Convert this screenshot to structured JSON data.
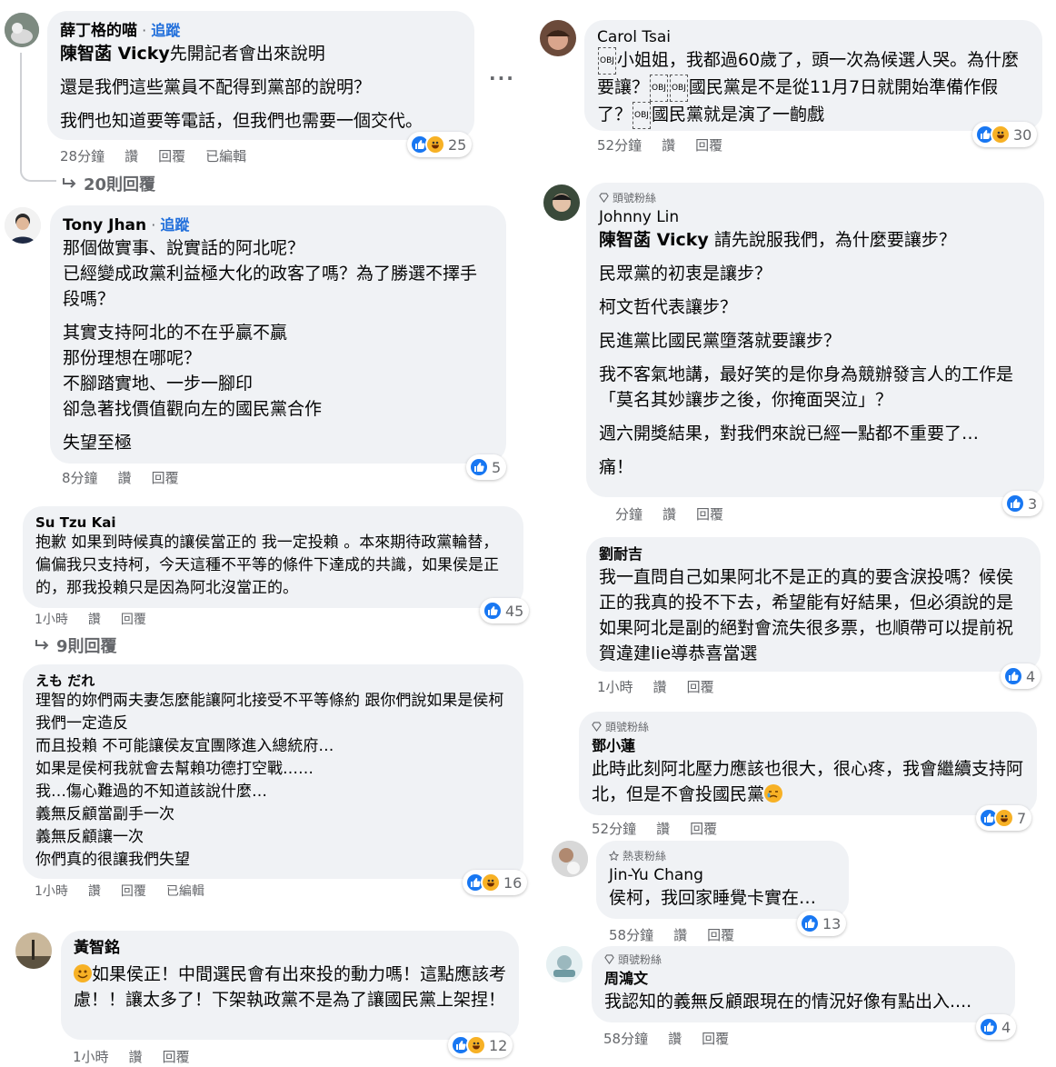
{
  "left": {
    "c1": {
      "name": "薛丁格的喵",
      "follow": "追蹤",
      "mention": "陳智菡 Vicky",
      "first": "先開記者會出來說明",
      "lines": [
        "還是我們這些黨員不配得到黨部的說明？",
        "我們也知道要等電話，但我們也需要一個交代。"
      ],
      "time": "28分鐘",
      "like": "讚",
      "reply": "回覆",
      "edited": "已編輯",
      "count": "25",
      "replies": "20則回覆"
    },
    "c2": {
      "name": "Tony Jhan",
      "follow": "追蹤",
      "p1": "那個做實事、說實話的阿北呢？\n已經變成政黨利益極大化的政客了嗎？為了勝選不擇手段嗎？",
      "p2": "其實支持阿北的不在乎贏不贏\n那份理想在哪呢？\n不腳踏實地、一步一腳印\n卻急著找價值觀向左的國民黨合作",
      "p3": "失望至極",
      "time": "8分鐘",
      "like": "讚",
      "reply": "回覆",
      "count": "5"
    },
    "c3": {
      "name": "Su Tzu Kai",
      "text": "抱歉 如果到時候真的讓侯當正的 我一定投賴 。本來期待政黨輪替，偏偏我只支持柯，今天這種不平等的條件下達成的共識，如果侯是正的，那我投賴只是因為阿北沒當正的。",
      "time": "1小時",
      "like": "讚",
      "reply": "回覆",
      "count": "45",
      "replies": "9則回覆"
    },
    "c4": {
      "name": "えも だれ",
      "text": "理智的妳們兩夫妻怎麼能讓阿北接受不平等條約 跟你們說如果是侯柯 我們一定造反\n而且投賴 不可能讓侯友宜團隊進入總統府…\n如果是侯柯我就會去幫賴功德打空戰……\n我…傷心難過的不知道該說什麼…\n義無反顧當副手一次\n義無反顧讓一次\n你們真的很讓我們失望",
      "time": "1小時",
      "like": "讚",
      "reply": "回覆",
      "edited": "已編輯",
      "count": "16"
    },
    "c5": {
      "name": "黃智銘",
      "text": "如果侯正！中間選民會有出來投的動力嗎！這點應該考慮！！讓太多了！下架執政黨不是為了讓國民黨上架捏！",
      "time": "1小時",
      "like": "讚",
      "reply": "回覆",
      "count": "12"
    }
  },
  "right": {
    "c1": {
      "name": "Carol Tsai",
      "t1": "小姐姐，我都過60歲了，頭一次為候選人哭。為什麼要讓？",
      "t2": "國民黨是不是從11月7日就開始準備作假了？",
      "t3": "國民黨就是演了一齣戲",
      "obj": "OBJ",
      "time": "52分鐘",
      "like": "讚",
      "reply": "回覆",
      "count": "30"
    },
    "c2": {
      "badge": "頭號粉絲",
      "name": "Johnny Lin",
      "mention": "陳智菡 Vicky",
      "first": " 請先說服我們，為什麼要讓步？",
      "lines": [
        "民眾黨的初衷是讓步？",
        "柯文哲代表讓步？",
        "民進黨比國民黨墮落就要讓步？",
        "我不客氣地講，最好笑的是你身為競辦發言人的工作是「莫名其妙讓步之後，你掩面哭泣」？",
        "週六開獎結果，對我們來說已經一點都不重要了…",
        "痛！"
      ],
      "time": "分鐘",
      "like": "讚",
      "reply": "回覆",
      "count": "3"
    },
    "c3": {
      "name": "劉耐吉",
      "text": "我一直問自己如果阿北不是正的真的要含淚投嗎？候侯正的我真的投不下去，希望能有好結果，但必須說的是如果阿北是副的絕對會流失很多票，也順帶可以提前祝賀違建lie導恭喜當選",
      "time": "1小時",
      "like": "讚",
      "reply": "回覆",
      "count": "4"
    },
    "c4": {
      "badge": "頭號粉絲",
      "name": "鄧小蓮",
      "text": "此時此刻阿北壓力應該也很大，很心疼，我會繼續支持阿北，但是不會投國民黨",
      "time": "52分鐘",
      "like": "讚",
      "reply": "回覆",
      "count": "7"
    },
    "c5": {
      "badge": "熱衷粉絲",
      "name": "Jin-Yu Chang",
      "text": "侯柯，我回家睡覺卡實在…",
      "time": "58分鐘",
      "like": "讚",
      "reply": "回覆",
      "count": "13"
    },
    "c6": {
      "badge": "頭號粉絲",
      "name": "周鴻文",
      "text": "我認知的義無反顧跟現在的情況好像有點出入....",
      "time": "58分鐘",
      "like": "讚",
      "reply": "回覆",
      "count": "4"
    }
  },
  "colors": {
    "bubble": "#f0f2f5",
    "like": "#1877f2",
    "haha": "#f7b125",
    "link": "#216fdb",
    "meta": "#65676b"
  },
  "icons": [
    "like-icon",
    "haha-icon",
    "reply-arrow-icon",
    "diamond-icon",
    "more-options-icon",
    "tear-emoji-icon",
    "smile-emoji-icon"
  ]
}
